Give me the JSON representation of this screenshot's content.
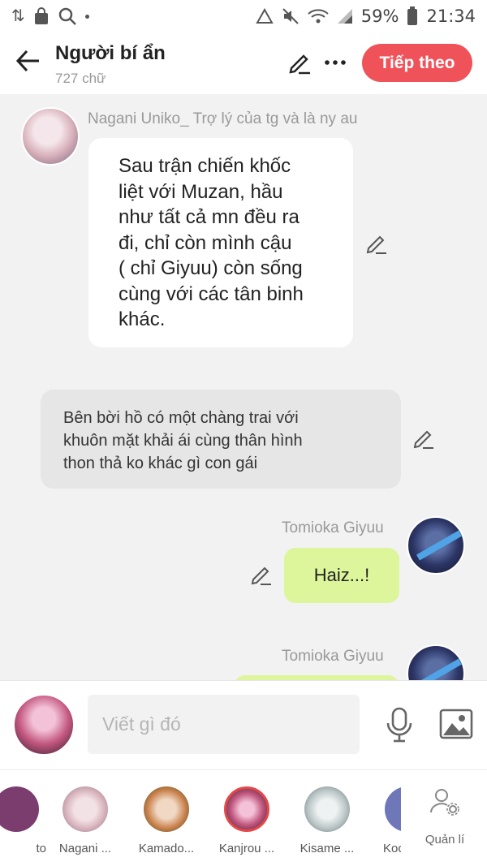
{
  "status_bar": {
    "battery": "59%",
    "time": "21:34"
  },
  "header": {
    "title": "Người bí ẩn",
    "subtitle": "727 chữ",
    "next_label": "Tiếp theo"
  },
  "messages": [
    {
      "type": "character",
      "sender": "Nagani Uniko_ Trợ lý của tg và là ny au",
      "lines": [
        "Sau trận chiến khốc",
        "liệt với Muzan, hầu",
        "như tất cả mn đều ra",
        "đi, chỉ còn mình cậu",
        "( chỉ Giyuu) còn sống",
        "cùng với các tân binh",
        "khác."
      ]
    },
    {
      "type": "narration",
      "lines": [
        "Bên bời hồ có một chàng trai với",
        "khuôn mặt khải ái cùng thân hình",
        "thon thả ko khác gì con gái"
      ]
    },
    {
      "type": "self",
      "sender": "Tomioka Giyuu",
      "text": "Haiz...!"
    },
    {
      "type": "self",
      "sender": "Tomioka Giyuu",
      "text": ""
    }
  ],
  "input": {
    "placeholder": "Viết gì đó"
  },
  "characters": [
    {
      "name": "to",
      "color": "#7b3d6e"
    },
    {
      "name": "Nagani ...",
      "color": "#d8b3bd"
    },
    {
      "name": "Kamado...",
      "color": "#c9804a"
    },
    {
      "name": "Kanjrou ...",
      "color": "#c3577f"
    },
    {
      "name": "Kisame ...",
      "color": "#b8c4c4"
    },
    {
      "name": "Koc",
      "color": "#6e78b8"
    }
  ],
  "manage_label": "Quản lí",
  "colors": {
    "accent": "#f0525a",
    "self_bubble": "#ddf59b",
    "narration_bubble": "#e6e6e6"
  }
}
